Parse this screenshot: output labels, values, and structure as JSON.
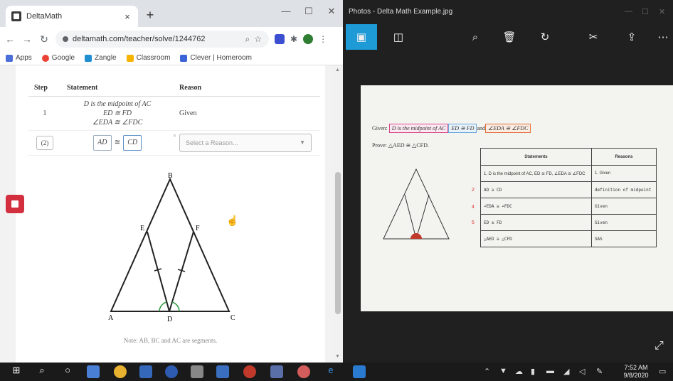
{
  "browser": {
    "tab_title": "DeltaMath",
    "tab_close": "×",
    "new_tab": "+",
    "url": "deltamath.com/teacher/solve/1244762",
    "bookmarks": [
      "Apps",
      "Google",
      "Zangle",
      "Classroom",
      "Clever | Homeroom"
    ]
  },
  "proof": {
    "header_step": "Step",
    "header_statement": "Statement",
    "header_reason": "Reason",
    "row1_step": "1",
    "row1_statements": [
      "D is the midpoint of AC",
      "ED ≅ FD",
      "∠EDA ≅ ∠FDC"
    ],
    "row1_reason": "Given",
    "row2_step": "(2)",
    "row2_seg_left": "AD",
    "row2_cong": "≅",
    "row2_seg_right": "CD",
    "row2_x": "×",
    "reason_placeholder": "Select a Reason..."
  },
  "figure": {
    "labels": {
      "A": "A",
      "B": "B",
      "C": "C",
      "D": "D",
      "E": "E",
      "F": "F"
    },
    "note": "Note: AB, BC and AC are segments."
  },
  "photos": {
    "title": "Photos - Delta Math Example.jpg",
    "given_prefix": "Given:",
    "given_1": "D is the midpoint of AC",
    "given_2": "ED ≅ FD",
    "given_and": "and",
    "given_3": "∠EDA ≅ ∠FDC",
    "prove": "Prove: △AED ≅ △CFD.",
    "table_header_statements": "Statements",
    "table_header_reasons": "Reasons",
    "rows": [
      {
        "num": "",
        "statement": "1. D is the midpoint of AC, ED ≅ FD, ∠EDA ≅ ∠FDC",
        "reason": "1. Given"
      },
      {
        "num": "2",
        "statement": "AD ≅ CD",
        "reason": "definition of midpoint"
      },
      {
        "num": "4",
        "statement": "∠EDA ≅ ∠FDC",
        "reason": "Given"
      },
      {
        "num": "5",
        "statement": "ED ≅ FD",
        "reason": "Given"
      },
      {
        "num": "",
        "statement": "△AED ≅ △CFD",
        "reason": "SAS"
      }
    ]
  },
  "taskbar": {
    "time": "7:52 AM",
    "date": "9/8/2020"
  }
}
